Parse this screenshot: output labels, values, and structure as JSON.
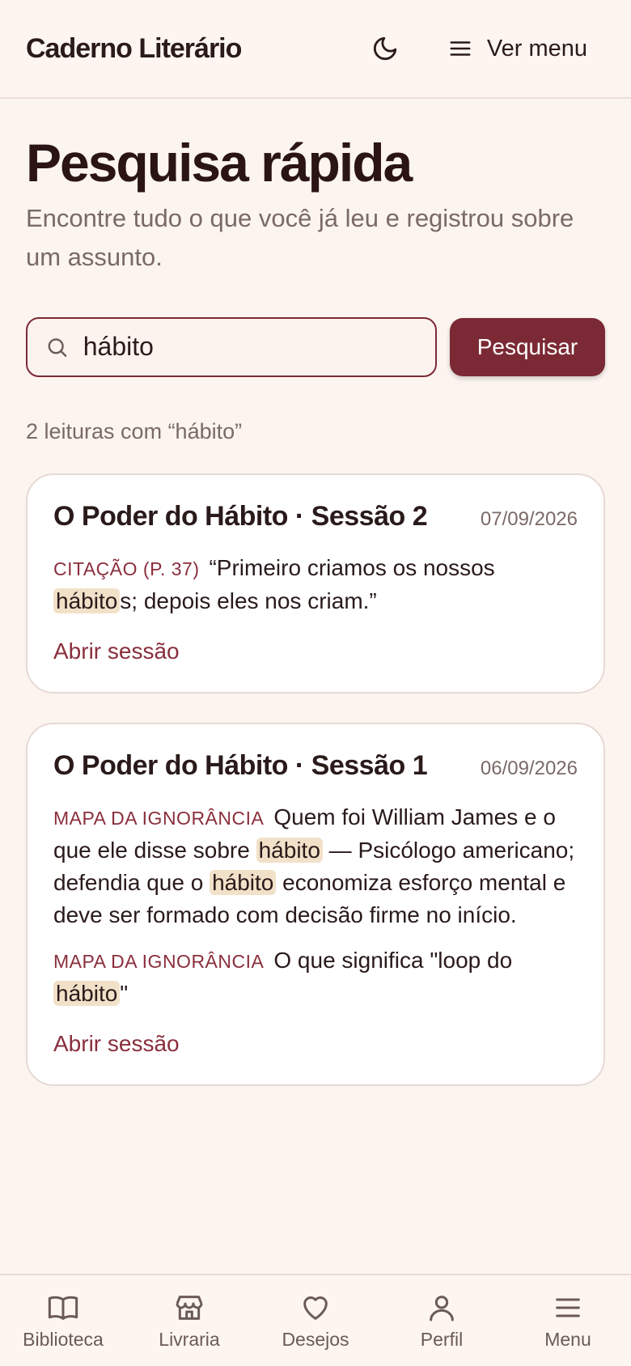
{
  "header": {
    "brand": "Caderno Literário",
    "menu_label": "Ver menu",
    "theme_icon": "moon-icon",
    "menu_icon": "hamburger-icon"
  },
  "page": {
    "title": "Pesquisa rápida",
    "subtitle": "Encontre tudo o que você já leu e registrou sobre um assunto."
  },
  "search": {
    "value": "hábito",
    "button_label": "Pesquisar",
    "icon": "search-icon"
  },
  "results": {
    "count_text": "2 leituras com “hábito”",
    "cards": [
      {
        "title": "O Poder do Hábito · Sessão 2",
        "date": "07/09/2026",
        "entries": [
          {
            "tag": "CITAÇÃO (P. 37)",
            "parts": [
              "“Primeiro criamos os nossos ",
              "hábito",
              "s; depois eles nos criam.”"
            ]
          }
        ],
        "link": "Abrir sessão"
      },
      {
        "title": "O Poder do Hábito · Sessão 1",
        "date": "06/09/2026",
        "entries": [
          {
            "tag": "MAPA DA IGNORÂNCIA",
            "parts": [
              "Quem foi William James e o que ele disse sobre ",
              "hábito",
              " — Psicólogo americano; defendia que o ",
              "hábito",
              " economiza esforço mental e deve ser formado com decisão firme no início."
            ]
          },
          {
            "tag": "MAPA DA IGNORÂNCIA",
            "parts": [
              "O que significa \"loop do ",
              "hábito",
              "\""
            ]
          }
        ],
        "link": "Abrir sessão"
      }
    ]
  },
  "bottom_nav": [
    {
      "label": "Biblioteca",
      "icon": "book-icon"
    },
    {
      "label": "Livraria",
      "icon": "store-icon"
    },
    {
      "label": "Desejos",
      "icon": "heart-icon"
    },
    {
      "label": "Perfil",
      "icon": "user-icon"
    },
    {
      "label": "Menu",
      "icon": "hamburger-icon"
    }
  ],
  "colors": {
    "accent": "#7b2a35",
    "background": "#fcf4ef",
    "highlight": "#f2e1c9"
  }
}
